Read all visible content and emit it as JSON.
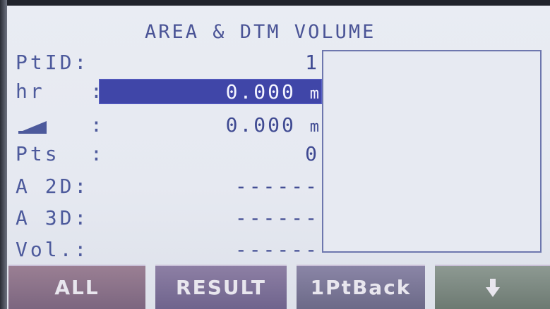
{
  "screen": {
    "title": "AREA & DTM VOLUME"
  },
  "fields": {
    "ptid": {
      "label": "PtID:",
      "value": "1"
    },
    "hr": {
      "label": "hr",
      "colon": ":",
      "value": "0.000",
      "unit": "m"
    },
    "slope": {
      "icon": "slope-icon",
      "colon": ":",
      "value": "0.000",
      "unit": "m"
    },
    "pts": {
      "label": "Pts",
      "colon": ":",
      "value": "0"
    },
    "a2d": {
      "label": "A 2D:",
      "value": "------"
    },
    "a3d": {
      "label": "A 3D:",
      "value": "------"
    },
    "vol": {
      "label": "Vol.:",
      "value": "------"
    }
  },
  "softkeys": {
    "all": "ALL",
    "result": "RESULT",
    "back": "1PtBack",
    "down_icon": "arrow-down-icon"
  },
  "colors": {
    "text": "#4d5a9c",
    "highlight": "#4046a8",
    "background": "#e9ecf3"
  }
}
